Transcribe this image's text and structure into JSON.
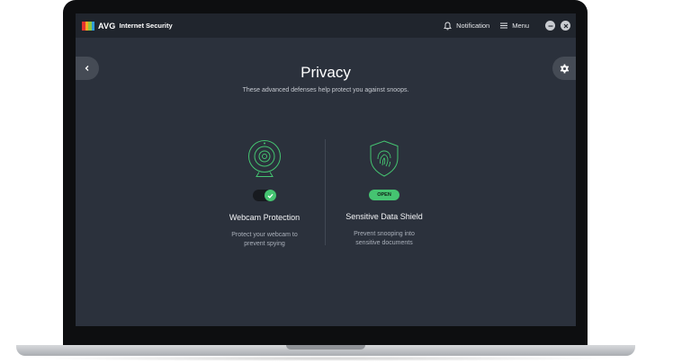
{
  "app": {
    "brand_short": "AVG",
    "brand_name": "Internet Security",
    "logo_colors": [
      "#e4332e",
      "#f7a823",
      "#8ec63f",
      "#2e9ad6"
    ]
  },
  "titlebar": {
    "notification_label": "Notification",
    "notification_icon": "bell-icon",
    "menu_label": "Menu",
    "menu_icon": "hamburger-icon",
    "minimize_icon": "minimize-icon",
    "close_icon": "close-icon"
  },
  "page": {
    "title": "Privacy",
    "subtitle": "These advanced defenses help protect you against snoops."
  },
  "features": [
    {
      "name": "Webcam Protection",
      "desc_line1": "Protect your webcam to",
      "desc_line2": "prevent spying",
      "icon": "webcam-icon",
      "control": "toggle",
      "enabled": true
    },
    {
      "name": "Sensitive Data Shield",
      "desc_line1": "Prevent snooping into",
      "desc_line2": "sensitive documents",
      "icon": "shield-fingerprint-icon",
      "control": "button",
      "button_label": "OPEN"
    }
  ],
  "colors": {
    "accent_green": "#45c471",
    "background": "#2b313c",
    "titlebar": "#20252d"
  }
}
